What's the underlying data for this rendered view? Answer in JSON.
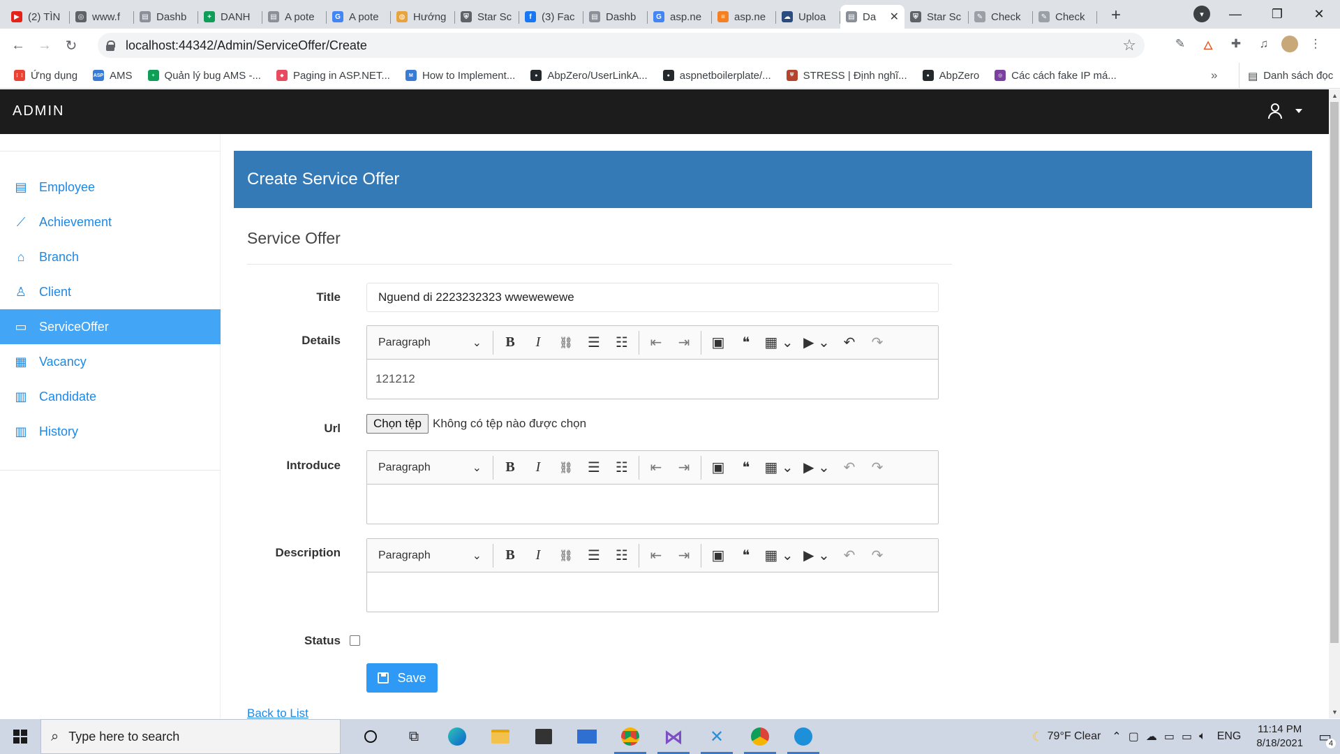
{
  "browser": {
    "tabs": [
      {
        "label": "(2) TÌN",
        "color": "#e62117",
        "glyph": "▶"
      },
      {
        "label": "www.f",
        "color": "#5f6368",
        "glyph": "◎"
      },
      {
        "label": "Dashb",
        "color": "#8a8f98",
        "glyph": "▤"
      },
      {
        "label": "DANH",
        "color": "#0f9d58",
        "glyph": "+"
      },
      {
        "label": "A pote",
        "color": "#8a8f98",
        "glyph": "▤"
      },
      {
        "label": "A pote",
        "color": "#4285f4",
        "glyph": "G"
      },
      {
        "label": "Hướng",
        "color": "#e8a33d",
        "glyph": "◍"
      },
      {
        "label": "Star Sc",
        "color": "#5f6368",
        "glyph": "⛨"
      },
      {
        "label": "(3) Fac",
        "color": "#1877f2",
        "glyph": "f"
      },
      {
        "label": "Dashb",
        "color": "#8a8f98",
        "glyph": "▤"
      },
      {
        "label": "asp.ne",
        "color": "#4285f4",
        "glyph": "G"
      },
      {
        "label": "asp.ne",
        "color": "#f48024",
        "glyph": "≡"
      },
      {
        "label": "Uploa",
        "color": "#2b4c7e",
        "glyph": "☁"
      },
      {
        "label": "Da",
        "color": "#8a8f98",
        "glyph": "▤",
        "active": true
      },
      {
        "label": "Star Sc",
        "color": "#5f6368",
        "glyph": "⛨"
      },
      {
        "label": "Check",
        "color": "#9aa0a6",
        "glyph": "✎"
      },
      {
        "label": "Check",
        "color": "#9aa0a6",
        "glyph": "✎"
      }
    ],
    "url": "localhost:44342/Admin/ServiceOffer/Create",
    "bookmarks": [
      {
        "label": "Ứng dụng",
        "color": "#ea4335",
        "glyph": "⋮⋮"
      },
      {
        "label": "AMS",
        "color": "#3a7bd5",
        "glyph": "ASP"
      },
      {
        "label": "Quản lý bug AMS -...",
        "color": "#0f9d58",
        "glyph": "+"
      },
      {
        "label": "Paging in ASP.NET...",
        "color": "#e84a5f",
        "glyph": "◆"
      },
      {
        "label": "How to Implement...",
        "color": "#3a7bd5",
        "glyph": "M"
      },
      {
        "label": "AbpZero/UserLinkA...",
        "color": "#24292e",
        "glyph": "●"
      },
      {
        "label": "aspnetboilerplate/...",
        "color": "#24292e",
        "glyph": "●"
      },
      {
        "label": "STRESS | Định nghĩ...",
        "color": "#b5442d",
        "glyph": "⛨"
      },
      {
        "label": "AbpZero",
        "color": "#24292e",
        "glyph": "●"
      },
      {
        "label": "Các cách fake IP má...",
        "color": "#7b3fa0",
        "glyph": "◎"
      }
    ],
    "reading_list": "Danh sách đọc"
  },
  "app": {
    "brand": "ADMIN",
    "sidebar": [
      {
        "label": "Employee",
        "icon": "employee-icon",
        "glyph": "▤"
      },
      {
        "label": "Achievement",
        "icon": "chart-line-icon",
        "glyph": "⟋"
      },
      {
        "label": "Branch",
        "icon": "home-icon",
        "glyph": "⌂"
      },
      {
        "label": "Client",
        "icon": "user-icon",
        "glyph": "♙"
      },
      {
        "label": "ServiceOffer",
        "icon": "folder-icon",
        "glyph": "▭",
        "active": true
      },
      {
        "label": "Vacancy",
        "icon": "table-icon",
        "glyph": "▦"
      },
      {
        "label": "Candidate",
        "icon": "columns-icon",
        "glyph": "▥"
      },
      {
        "label": "History",
        "icon": "columns-icon",
        "glyph": "▥"
      }
    ],
    "header": "Create Service Offer",
    "section": "Service Offer",
    "form": {
      "title_label": "Title",
      "title_value": "Nguend di 2223232323  wwewewewe",
      "details_label": "Details",
      "details_value": "121212",
      "url_label": "Url",
      "file_button": "Chọn tệp",
      "file_status": "Không có tệp nào được chọn",
      "introduce_label": "Introduce",
      "description_label": "Description",
      "status_label": "Status",
      "save_label": "Save",
      "back_link": "Back to List",
      "paragraph": "Paragraph"
    }
  },
  "taskbar": {
    "search_placeholder": "Type here to search",
    "weather": "79°F  Clear",
    "lang": "ENG",
    "time": "11:14 PM",
    "date": "8/18/2021",
    "notifications": "4"
  }
}
